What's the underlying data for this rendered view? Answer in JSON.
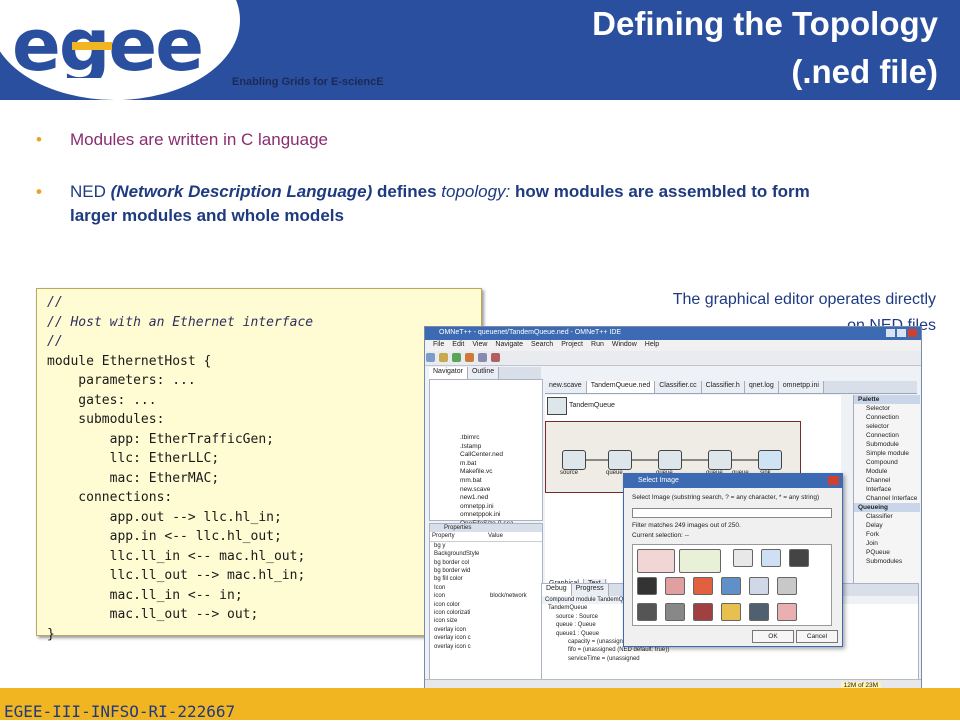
{
  "header": {
    "logo_text": "egee",
    "tagline": "Enabling Grids for E-sciencE",
    "title_line1": "Defining the Topology",
    "title_line2": "(.ned file)"
  },
  "bullets": {
    "b1": "Modules are written in C language",
    "b2_ned": "NED",
    "b2_expansion": "(Network Description Language)",
    "b2_defines": "defines",
    "b2_topology": "topology:",
    "b2_rest": "how modules are assembled to form larger modules and whole models"
  },
  "code_lines": [
    "//",
    "// Host with an Ethernet interface",
    "//",
    "module EthernetHost {",
    "    parameters: ...",
    "    gates: ...",
    "    submodules:",
    "        app: EtherTrafficGen;",
    "        llc: EtherLLC;",
    "        mac: EtherMAC;",
    "    connections:",
    "        app.out --> llc.hl_in;",
    "        app.in <-- llc.hl_out;",
    "        llc.ll_in <-- mac.hl_out;",
    "        llc.ll_out --> mac.hl_in;",
    "        mac.ll_in <-- in;",
    "        mac.ll_out --> out;",
    "}"
  ],
  "caption": {
    "line1": "The graphical editor operates directly",
    "line2": "on NED files"
  },
  "footer": {
    "text": "EGEE-III-INFSO-RI-222667"
  },
  "ide": {
    "window_title": "OMNeT++ - queuenet/TandemQueue.ned - OMNeT++ IDE",
    "menu": [
      "File",
      "Edit",
      "View",
      "Navigate",
      "Search",
      "Project",
      "Run",
      "Window",
      "Help"
    ],
    "left_tabs": [
      "Navigator",
      "Outline"
    ],
    "editor_tabs": [
      "new.scave",
      "TandemQueue.ned",
      "Classifier.cc",
      "Classifier.h",
      "qnet.log",
      "omnetpp.ini"
    ],
    "files": [
      ".tbimrc",
      ".tstamp",
      "CallCenter.ned",
      "m.bat",
      "Makefile.vc",
      "mm.bat",
      "new.scave",
      "new1.ned",
      "omnetpp.ini",
      "omnetppok.ini",
      "OneFifoSize-0.sca"
    ],
    "compound_name": "TandemQueue",
    "node_labels": [
      "source",
      "queue",
      "queue",
      "queue",
      "queue",
      "sink"
    ],
    "palette_header": "Palette",
    "palette_items": [
      "Selector",
      "Connection selector",
      "Connection",
      "Submodule",
      "Simple module",
      "Compound Module",
      "Channel",
      "Interface",
      "Channel Interface"
    ],
    "palette_header2": "Queueing",
    "palette_items2": [
      "Classifier",
      "Delay",
      "Fork",
      "Join",
      "PQueue",
      "Submodules"
    ],
    "dialog": {
      "title": "Select Image",
      "prompt": "Select Image (substring search, ? = any character, * = any string)",
      "filter_text": "Filter matches 249 images out of 250.",
      "current": "Current selection: --",
      "ok": "OK",
      "cancel": "Cancel"
    },
    "props_tab": "Properties",
    "props_header": [
      "Property",
      "Value"
    ],
    "props_rows": [
      "bg y",
      "BackgroundStyle",
      "bg border col",
      "bg border wid",
      "bg fill color",
      "Icon",
      "icon",
      "icon color",
      "icon colorizati",
      "icon size",
      "overlay icon",
      "overlay icon c",
      "overlay icon c"
    ],
    "props_value": "block/network",
    "bottom_tabs": [
      "Graphical",
      "Text"
    ],
    "debug_tabs": [
      "Debug",
      "Progress"
    ],
    "debug_header": "Compound module TandemQueue",
    "debug_rows": [
      "TandemQueue",
      "source : Source",
      "queue : Queue",
      "queue1 : Queue",
      "capacity = (unassigned (NED default: -1))",
      "fifo = (unassigned (NED default: true))",
      "serviceTime = (unassigned"
    ],
    "status": "12M of 23M"
  }
}
